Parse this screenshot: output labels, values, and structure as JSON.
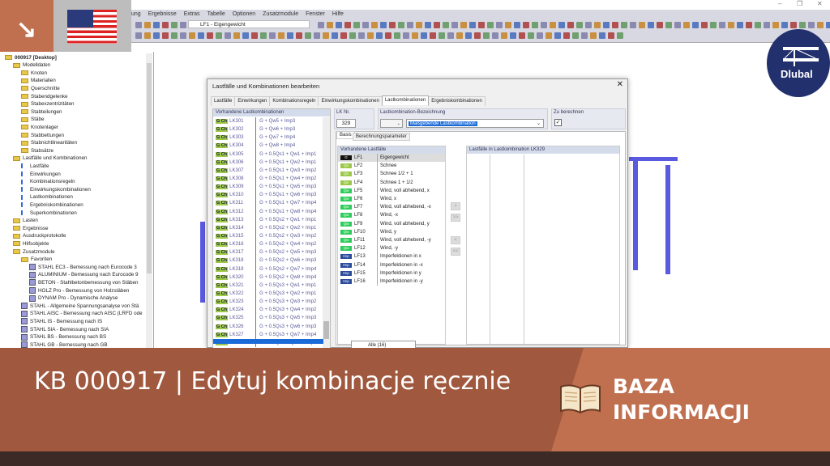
{
  "menu": [
    "ung",
    "Ergebnisse",
    "Extras",
    "Tabelle",
    "Optionen",
    "Zusatzmodule",
    "Fenster",
    "Hilfe"
  ],
  "toolbar": {
    "loadcase_select": "LF1 - Eigengewicht"
  },
  "tree": [
    {
      "label": "000917 [Desktop]",
      "level": 0,
      "icon": "project"
    },
    {
      "label": "Modelldaten",
      "level": 1,
      "icon": "folder"
    },
    {
      "label": "Knoten",
      "level": 2,
      "icon": "folder"
    },
    {
      "label": "Materialien",
      "level": 2,
      "icon": "folder"
    },
    {
      "label": "Querschnitte",
      "level": 2,
      "icon": "folder"
    },
    {
      "label": "Stabendgelenke",
      "level": 2,
      "icon": "folder"
    },
    {
      "label": "Stabexzentrizitäten",
      "level": 2,
      "icon": "folder"
    },
    {
      "label": "Stabteilungen",
      "level": 2,
      "icon": "folder"
    },
    {
      "label": "Stäbe",
      "level": 2,
      "icon": "folder"
    },
    {
      "label": "Knotenlager",
      "level": 2,
      "icon": "folder"
    },
    {
      "label": "Stabbettungen",
      "level": 2,
      "icon": "folder"
    },
    {
      "label": "Stabnichtlinearitäten",
      "level": 2,
      "icon": "folder"
    },
    {
      "label": "Stabsätze",
      "level": 2,
      "icon": "folder"
    },
    {
      "label": "Lastfälle und Kombinationen",
      "level": 1,
      "icon": "folder"
    },
    {
      "label": "Lastfälle",
      "level": 2,
      "icon": "item"
    },
    {
      "label": "Einwirkungen",
      "level": 2,
      "icon": "item"
    },
    {
      "label": "Kombinationsregeln",
      "level": 2,
      "icon": "item"
    },
    {
      "label": "Einwirkungskombinationen",
      "level": 2,
      "icon": "item"
    },
    {
      "label": "Lastkombinationen",
      "level": 2,
      "icon": "item"
    },
    {
      "label": "Ergebniskombinationen",
      "level": 2,
      "icon": "item"
    },
    {
      "label": "Superkombinationen",
      "level": 2,
      "icon": "item"
    },
    {
      "label": "Lasten",
      "level": 1,
      "icon": "folder"
    },
    {
      "label": "Ergebnisse",
      "level": 1,
      "icon": "folder"
    },
    {
      "label": "Ausdruckprotokolle",
      "level": 1,
      "icon": "folder"
    },
    {
      "label": "Hilfsobjekte",
      "level": 1,
      "icon": "folder"
    },
    {
      "label": "Zusatzmodule",
      "level": 1,
      "icon": "folder"
    },
    {
      "label": "Favoriten",
      "level": 2,
      "icon": "folder"
    },
    {
      "label": "STAHL EC3 - Bemessung nach Eurocode 3",
      "level": 3,
      "icon": "module"
    },
    {
      "label": "ALUMINIUM - Bemessung nach Eurocode 9",
      "level": 3,
      "icon": "module"
    },
    {
      "label": "BETON - Stahlbetonbemessung von Stäben",
      "level": 3,
      "icon": "module"
    },
    {
      "label": "HOLZ Pro - Bemessung von Holzstäben",
      "level": 3,
      "icon": "module"
    },
    {
      "label": "DYNAM Pro - Dynamische Analyse",
      "level": 3,
      "icon": "module"
    },
    {
      "label": "STAHL - Allgemeine Spannungsanalyse von Stä",
      "level": 2,
      "icon": "module"
    },
    {
      "label": "STAHL AISC - Bemessung nach AISC (LRFD ode",
      "level": 2,
      "icon": "module"
    },
    {
      "label": "STAHL IS - Bemessung nach IS",
      "level": 2,
      "icon": "module"
    },
    {
      "label": "STAHL SIA - Bemessung nach SIA",
      "level": 2,
      "icon": "module"
    },
    {
      "label": "STAHL BS - Bemessung nach BS",
      "level": 2,
      "icon": "module"
    },
    {
      "label": "STAHL GB - Bemessung nach GB",
      "level": 2,
      "icon": "module"
    }
  ],
  "dialog": {
    "title": "Lastfälle und Kombinationen bearbeiten",
    "tabs": [
      "Lastfälle",
      "Einwirkungen",
      "Kombinationsregeln",
      "Einwirkungskombinationen",
      "Lastkombinationen",
      "Ergebniskombinationen"
    ],
    "active_tab": 4,
    "existing_lk_header": "Vorhandene Lastkombinationen",
    "lk_badge": "G Ch",
    "lk_list": [
      [
        "LK301",
        "G + Qw5 + Imp3"
      ],
      [
        "LK302",
        "G + Qw6 + Imp3"
      ],
      [
        "LK303",
        "G + Qw7 + Imp4"
      ],
      [
        "LK304",
        "G + Qw8 + Imp4"
      ],
      [
        "LK305",
        "G + 0.5Qs1 + Qw1 + Imp1"
      ],
      [
        "LK306",
        "G + 0.5Qs1 + Qw2 + Imp1"
      ],
      [
        "LK307",
        "G + 0.5Qs1 + Qw3 + Imp2"
      ],
      [
        "LK308",
        "G + 0.5Qs1 + Qw4 + Imp2"
      ],
      [
        "LK309",
        "G + 0.5Qs1 + Qw5 + Imp3"
      ],
      [
        "LK310",
        "G + 0.5Qs1 + Qw6 + Imp3"
      ],
      [
        "LK311",
        "G + 0.5Qs1 + Qw7 + Imp4"
      ],
      [
        "LK312",
        "G + 0.5Qs1 + Qw8 + Imp4"
      ],
      [
        "LK313",
        "G + 0.5Qs2 + Qw1 + Imp1"
      ],
      [
        "LK314",
        "G + 0.5Qs2 + Qw2 + Imp1"
      ],
      [
        "LK315",
        "G + 0.5Qs2 + Qw3 + Imp2"
      ],
      [
        "LK316",
        "G + 0.5Qs2 + Qw4 + Imp2"
      ],
      [
        "LK317",
        "G + 0.5Qs2 + Qw5 + Imp3"
      ],
      [
        "LK318",
        "G + 0.5Qs2 + Qw6 + Imp3"
      ],
      [
        "LK319",
        "G + 0.5Qs2 + Qw7 + Imp4"
      ],
      [
        "LK320",
        "G + 0.5Qs2 + Qw8 + Imp4"
      ],
      [
        "LK321",
        "G + 0.5Qs3 + Qw1 + Imp1"
      ],
      [
        "LK322",
        "G + 0.5Qs3 + Qw2 + Imp1"
      ],
      [
        "LK323",
        "G + 0.5Qs3 + Qw3 + Imp2"
      ],
      [
        "LK324",
        "G + 0.5Qs3 + Qw4 + Imp2"
      ],
      [
        "LK325",
        "G + 0.5Qs3 + Qw5 + Imp3"
      ],
      [
        "LK326",
        "G + 0.5Qs3 + Qw6 + Imp3"
      ],
      [
        "LK327",
        "G + 0.5Qs3 + Qw7 + Imp4"
      ],
      [
        "LK328",
        "G + 0.5Qs3 + Qw8 + Imp4"
      ]
    ],
    "lk_nr_label": "LK Nr.",
    "lk_nr": "329",
    "name_label": "Lastkombination-Bezeichnung",
    "name_value": "Maßgebende Lastkombination",
    "calc_label": "Zu berechnen",
    "subtabs": [
      "Basis",
      "Berechnungsparameter"
    ],
    "existing_lf_header": "Vorhandene Lastfälle",
    "lf_list": [
      {
        "badge": "G",
        "id": "LF1",
        "desc": "Eigengewicht",
        "color": "#111111"
      },
      {
        "badge": "Qs",
        "id": "LF2",
        "desc": "Schnee",
        "color": "#9cc84a"
      },
      {
        "badge": "Qs",
        "id": "LF3",
        "desc": "Schnee 1/2 + 1",
        "color": "#9cc84a"
      },
      {
        "badge": "Qs",
        "id": "LF4",
        "desc": "Schnee 1 + 1/2",
        "color": "#9cc84a"
      },
      {
        "badge": "Qw",
        "id": "LF5",
        "desc": "Wind, voll abhebend, x",
        "color": "#2ecc5a"
      },
      {
        "badge": "Qw",
        "id": "LF6",
        "desc": "Wind, x",
        "color": "#2ecc5a"
      },
      {
        "badge": "Qw",
        "id": "LF7",
        "desc": "Wind, voll abhebend, -x",
        "color": "#2ecc5a"
      },
      {
        "badge": "Qw",
        "id": "LF8",
        "desc": "Wind, -x",
        "color": "#2ecc5a"
      },
      {
        "badge": "Qw",
        "id": "LF9",
        "desc": "Wind, voll abhebend, y",
        "color": "#2ecc5a"
      },
      {
        "badge": "Qw",
        "id": "LF10",
        "desc": "Wind, y",
        "color": "#2ecc5a"
      },
      {
        "badge": "Qw",
        "id": "LF11",
        "desc": "Wind, voll abhebend, -y",
        "color": "#2ecc5a"
      },
      {
        "badge": "Qw",
        "id": "LF12",
        "desc": "Wind, -y",
        "color": "#2ecc5a"
      },
      {
        "badge": "Imp",
        "id": "LF13",
        "desc": "Imperfektionen in x",
        "color": "#2a4a9a"
      },
      {
        "badge": "Imp",
        "id": "LF14",
        "desc": "Imperfektionen in -x",
        "color": "#2a4a9a"
      },
      {
        "badge": "Imp",
        "id": "LF15",
        "desc": "Imperfektionen in y",
        "color": "#2a4a9a"
      },
      {
        "badge": "Imp",
        "id": "LF16",
        "desc": "Imperfektionen in -y",
        "color": "#2a4a9a"
      }
    ],
    "included_header": "Lastfälle in Lastkombination LK329",
    "filter_value": "Alle (16)",
    "buttons": {
      "add": ">",
      "add_all": ">>",
      "remove": "<",
      "remove_all": "<<"
    }
  },
  "banner": {
    "title": "KB 000917 | Edytuj kombinacje ręcznie",
    "category": "BAZA INFORMACJI",
    "brand": "Dlubal"
  },
  "colors": {
    "accent": "#c0704f",
    "banner": "#a0583e",
    "brand": "#23306e"
  }
}
